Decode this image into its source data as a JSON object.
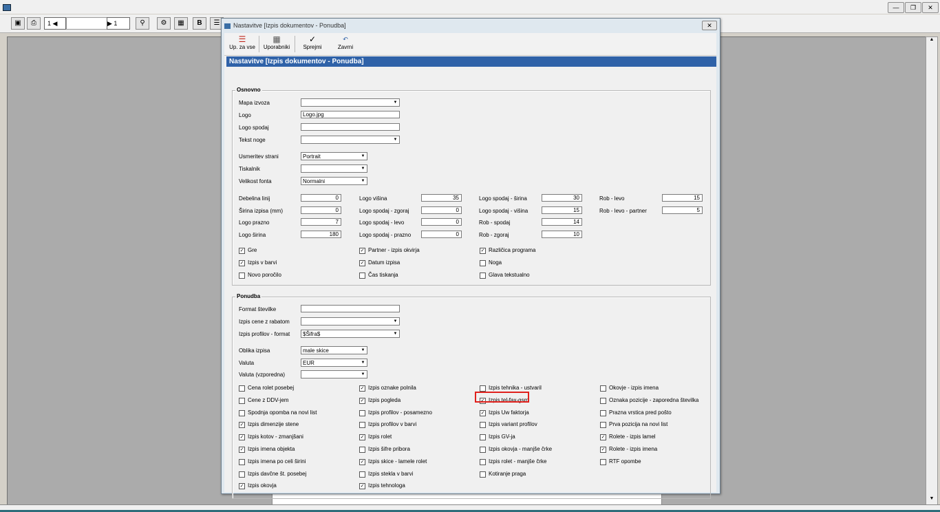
{
  "outer": {
    "page_current": "1",
    "page_total": "1",
    "b_label": "B"
  },
  "dialog": {
    "title": "Nastavitve [Izpis dokumentov - Ponudba]",
    "header": "Nastavitve [Izpis dokumentov - Ponudba]",
    "toolbar": {
      "upzavse": "Up. za vse",
      "uporabniki": "Uporabniki",
      "sprejmi": "Sprejmi",
      "zavrni": "Zavrni"
    },
    "osnovno": {
      "title": "Osnovno",
      "mapa_izvoza": {
        "label": "Mapa izvoza",
        "value": ""
      },
      "logo": {
        "label": "Logo",
        "value": "Logo.jpg"
      },
      "logo_spodaj": {
        "label": "Logo spodaj",
        "value": ""
      },
      "tekst_noge": {
        "label": "Tekst noge",
        "value": ""
      },
      "usmeritev": {
        "label": "Usmeritev strani",
        "value": "Portrait"
      },
      "tiskalnik": {
        "label": "Tiskalnik",
        "value": ""
      },
      "velikost": {
        "label": "Velikost fonta",
        "value": "Normalni"
      },
      "numfields": [
        {
          "label": "Debelina linij",
          "value": "0"
        },
        {
          "label": "Širina izpisa (mm)",
          "value": "0"
        },
        {
          "label": "Logo prazno",
          "value": "7"
        },
        {
          "label": "Logo širina",
          "value": "180"
        },
        {
          "label": "Logo višina",
          "value": "35"
        },
        {
          "label": "Logo spodaj - zgoraj",
          "value": "0"
        },
        {
          "label": "Logo spodaj - levo",
          "value": "0"
        },
        {
          "label": "Logo spodaj - prazno",
          "value": "0"
        },
        {
          "label": "Logo spodaj - širina",
          "value": "30"
        },
        {
          "label": "Logo spodaj - višina",
          "value": "15"
        },
        {
          "label": "Rob - spodaj",
          "value": "14"
        },
        {
          "label": "Rob - zgoraj",
          "value": "10"
        },
        {
          "label": "Rob - levo",
          "value": "15"
        },
        {
          "label": "Rob - levo - partner",
          "value": "5"
        }
      ],
      "checks": [
        {
          "label": "Gre",
          "checked": true
        },
        {
          "label": "Izpis v barvi",
          "checked": true
        },
        {
          "label": "Novo poročilo",
          "checked": false
        },
        {
          "label": "Partner - izpis okvirja",
          "checked": true
        },
        {
          "label": "Datum izpisa",
          "checked": true
        },
        {
          "label": "Čas tiskanja",
          "checked": false
        },
        {
          "label": "Različica programa",
          "checked": true
        },
        {
          "label": "Noga",
          "checked": false
        },
        {
          "label": "Glava tekstualno",
          "checked": false
        }
      ]
    },
    "ponudba": {
      "title": "Ponudba",
      "format": {
        "label": "Format številke",
        "value": ""
      },
      "cene_rabat": {
        "label": "Izpis cene z rabatom",
        "value": ""
      },
      "profilov_format": {
        "label": "Izpis profilov - format",
        "value": "$Šifra$"
      },
      "oblika": {
        "label": "Oblika izpisa",
        "value": "male skice"
      },
      "valuta": {
        "label": "Valuta",
        "value": "EUR"
      },
      "valuta_vzp": {
        "label": "Valuta (vzporedna)",
        "value": ""
      },
      "checks": [
        {
          "label": "Cena rolet posebej",
          "checked": false
        },
        {
          "label": "Cene z DDV-jem",
          "checked": false
        },
        {
          "label": "Spodnja opomba na novi list",
          "checked": false
        },
        {
          "label": "Izpis dimenzije stene",
          "checked": true
        },
        {
          "label": "Izpis kotov - zmanjšani",
          "checked": true
        },
        {
          "label": "Izpis imena objekta",
          "checked": true
        },
        {
          "label": "Izpis imena po celi širini",
          "checked": false
        },
        {
          "label": "Izpis davčne št. posebej",
          "checked": false
        },
        {
          "label": "Izpis okovja",
          "checked": true
        },
        {
          "label": "Izpis oznake polnila",
          "checked": true
        },
        {
          "label": "Izpis pogleda",
          "checked": true
        },
        {
          "label": "Izpis profilov - posamezno",
          "checked": false
        },
        {
          "label": "Izpis profilov v barvi",
          "checked": false
        },
        {
          "label": "Izpis rolet",
          "checked": true
        },
        {
          "label": "Izpis šifre pribora",
          "checked": false
        },
        {
          "label": "Izpis skice - lamele rolet",
          "checked": true
        },
        {
          "label": "Izpis stekla v barvi",
          "checked": false
        },
        {
          "label": "Izpis tehnologa",
          "checked": true
        },
        {
          "label": "Izpis tehnika - ustvaril",
          "checked": false
        },
        {
          "label": "Izpis tel-fax-gsm",
          "checked": true
        },
        {
          "label": "Izpis Uw faktorja",
          "checked": true
        },
        {
          "label": "Izpis variant profilov",
          "checked": false
        },
        {
          "label": "Izpis GV-ja",
          "checked": false
        },
        {
          "label": "Izpis okovja - manjše črke",
          "checked": false
        },
        {
          "label": "Izpis rolet - manjše črke",
          "checked": false
        },
        {
          "label": "Kotiranje praga",
          "checked": false
        },
        {
          "label": "Okovje - izpis imena",
          "checked": false
        },
        {
          "label": "Oznaka pozicije - zaporedna številka",
          "checked": false
        },
        {
          "label": "Prazna vrstica pred pošto",
          "checked": false
        },
        {
          "label": "Prva pozicija na novi list",
          "checked": false
        },
        {
          "label": "Rolete - izpis lamel",
          "checked": true
        },
        {
          "label": "Rolete - izpis imena",
          "checked": true
        },
        {
          "label": "RTF opombe",
          "checked": false
        }
      ]
    }
  },
  "colors": {
    "header_bg": "#2f62a8",
    "highlight": "#e0201c"
  }
}
